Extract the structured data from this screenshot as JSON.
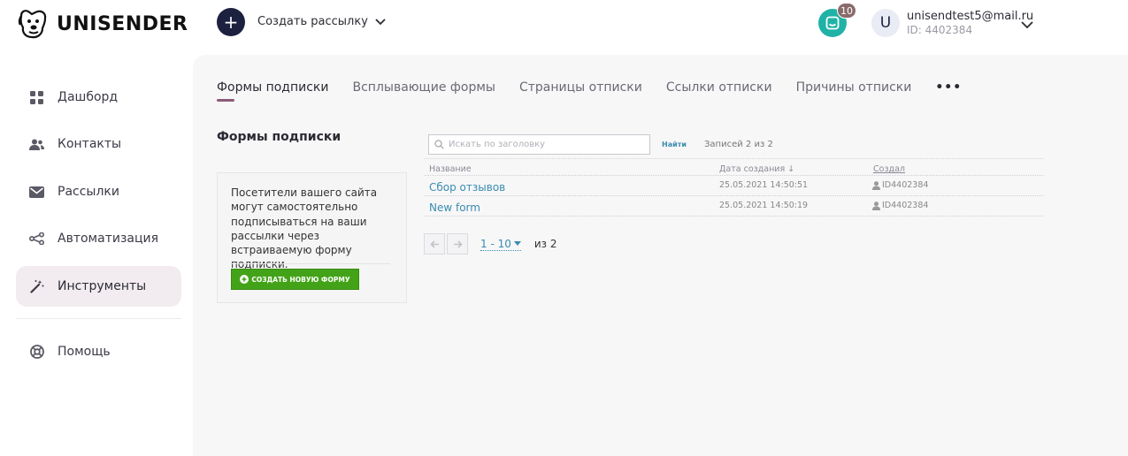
{
  "header": {
    "logo_text": "UNISENDER",
    "create_label": "Создать рассылку",
    "notifications_count": "10",
    "user_initial": "U",
    "user_email": "unisendtest5@mail.ru",
    "user_id": "ID: 4402384"
  },
  "sidebar": {
    "items": [
      {
        "label": "Дашборд",
        "icon": "dashboard-icon"
      },
      {
        "label": "Контакты",
        "icon": "contacts-icon"
      },
      {
        "label": "Рассылки",
        "icon": "mail-icon"
      },
      {
        "label": "Автоматизация",
        "icon": "automation-icon"
      },
      {
        "label": "Инструменты",
        "icon": "magic-wand-icon",
        "active": true
      },
      {
        "label": "Помощь",
        "icon": "help-icon"
      }
    ]
  },
  "tabs": [
    {
      "label": "Формы подписки",
      "active": true
    },
    {
      "label": "Всплывающие формы"
    },
    {
      "label": "Страницы отписки"
    },
    {
      "label": "Ссылки отписки"
    },
    {
      "label": "Причины отписки"
    }
  ],
  "tab_more": "•••",
  "content": {
    "section_title": "Формы подписки",
    "info_text": "Посетители вашего сайта могут самостоятельно подписываться на ваши рассылки через встраиваемую форму подписки.",
    "cta_label": "Создать новую форму",
    "search_placeholder": "Искать по заголовку",
    "search_button": "Найти",
    "records_text": "Записей 2 из 2",
    "columns": {
      "name": "Название",
      "date": "Дата создания ↓",
      "creator": "Создал"
    },
    "rows": [
      {
        "name": "Сбор отзывов",
        "date": "25.05.2021 14:50:51",
        "creator": "ID4402384"
      },
      {
        "name": "New form",
        "date": "25.05.2021 14:50:19",
        "creator": "ID4402384"
      }
    ],
    "pager_range": "1 - 10",
    "pager_total": "из 2"
  },
  "colors": {
    "accent": "#1d2140",
    "notification": "#20b2a6",
    "active_nav": "#f2ecf1",
    "tab_indicator": "#8b5a78",
    "link": "#3a8bb0",
    "cta": "#43a318"
  }
}
